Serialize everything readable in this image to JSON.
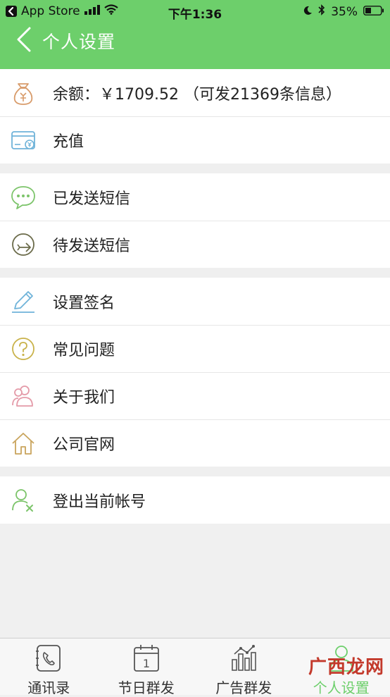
{
  "status_bar": {
    "back_app": "App Store",
    "time": "下午1:36",
    "battery": "35%"
  },
  "nav": {
    "title": "个人设置"
  },
  "groups": [
    {
      "items": [
        {
          "icon": "money-bag-icon",
          "label": "余额：￥1709.52  （可发21369条信息）"
        },
        {
          "icon": "recharge-card-icon",
          "label": "充值"
        }
      ]
    },
    {
      "items": [
        {
          "icon": "chat-bubble-icon",
          "label": "已发送短信"
        },
        {
          "icon": "pending-send-icon",
          "label": "待发送短信"
        }
      ]
    },
    {
      "items": [
        {
          "icon": "pencil-icon",
          "label": "设置签名"
        },
        {
          "icon": "question-icon",
          "label": "常见问题"
        },
        {
          "icon": "users-icon",
          "label": "关于我们"
        },
        {
          "icon": "home-icon",
          "label": "公司官网"
        }
      ]
    },
    {
      "items": [
        {
          "icon": "logout-user-icon",
          "label": "登出当前帐号"
        }
      ]
    }
  ],
  "tabs": [
    {
      "icon": "contacts-icon",
      "label": "通讯录",
      "active": false
    },
    {
      "icon": "calendar-icon",
      "label": "节日群发",
      "active": false,
      "calendar_day": "1"
    },
    {
      "icon": "ad-chart-icon",
      "label": "广告群发",
      "active": false
    },
    {
      "icon": "profile-icon",
      "label": "个人设置",
      "active": true
    }
  ],
  "watermark": "广西龙网",
  "colors": {
    "header_green": "#6dcf6b",
    "icon_green": "#7cc46a",
    "icon_gold": "#c9a45c",
    "icon_blue": "#6fb3d9",
    "icon_pink": "#e49aa8"
  }
}
